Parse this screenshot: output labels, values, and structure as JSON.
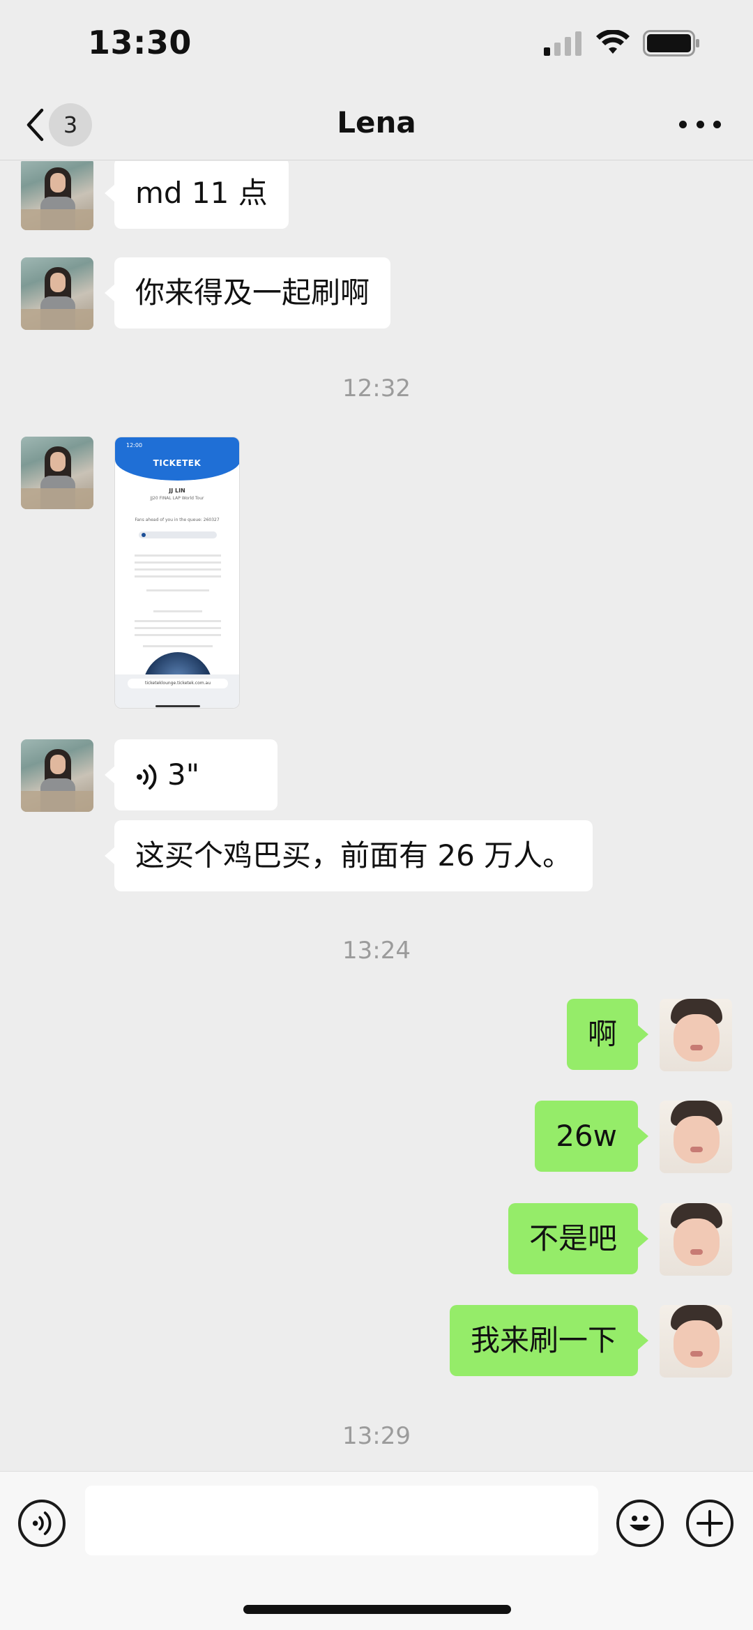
{
  "status_bar": {
    "time": "13:30"
  },
  "nav": {
    "back_count": "3",
    "title": "Lena"
  },
  "messages": {
    "m1": "md 11 点",
    "m2": "你来得及一起刷啊",
    "ts1": "12:32",
    "screenshot": {
      "time": "12:00",
      "logo": "TICKETEK",
      "artist": "JJ LIN",
      "tour": "JJ20 FINAL LAP World Tour",
      "queue_text": "Fans ahead of you in the queue: 260327",
      "url": "ticketeklounge.ticketek.com.au"
    },
    "voice_duration": "3\"",
    "m3": "这买个鸡巴买，前面有 26 万人。",
    "ts2": "13:24",
    "r1": "啊",
    "r2": "26w",
    "r3": "不是吧",
    "r4": "我来刷一下",
    "ts3": "13:29"
  },
  "input": {
    "value": ""
  },
  "colors": {
    "sent_bubble": "#95ec69",
    "received_bubble": "#ffffff",
    "background": "#ededed"
  },
  "icons": [
    "back-chevron-icon",
    "more-icon",
    "voice-wave-icon",
    "emoji-icon",
    "plus-icon",
    "signal-icon",
    "wifi-icon",
    "battery-icon"
  ]
}
